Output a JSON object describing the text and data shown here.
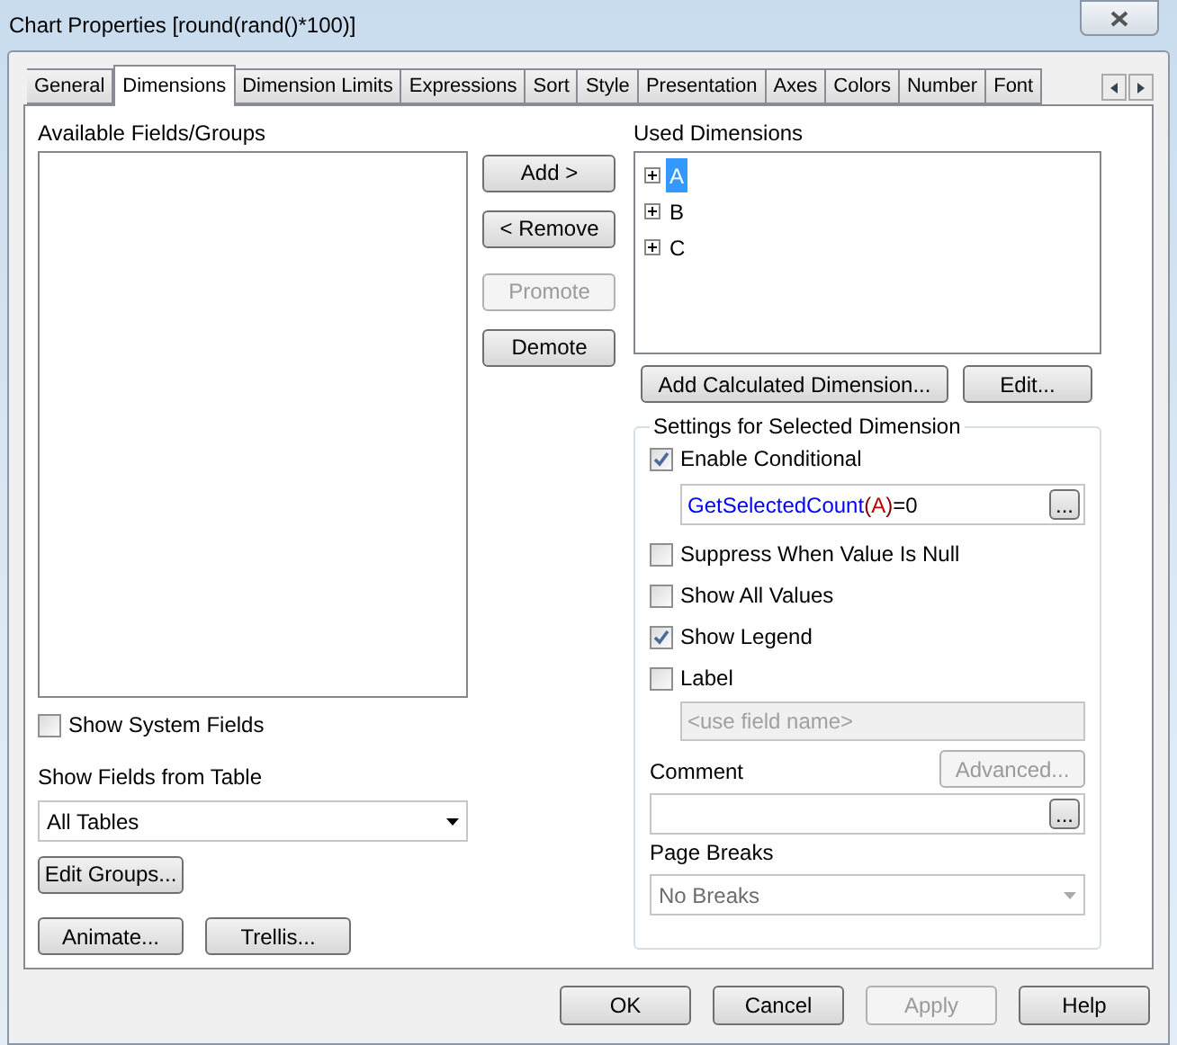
{
  "window": {
    "title": "Chart Properties [round(rand()*100)]"
  },
  "tabs": [
    {
      "label": "General",
      "selected": false
    },
    {
      "label": "Dimensions",
      "selected": true
    },
    {
      "label": "Dimension Limits",
      "selected": false
    },
    {
      "label": "Expressions",
      "selected": false
    },
    {
      "label": "Sort",
      "selected": false
    },
    {
      "label": "Style",
      "selected": false
    },
    {
      "label": "Presentation",
      "selected": false
    },
    {
      "label": "Axes",
      "selected": false
    },
    {
      "label": "Colors",
      "selected": false
    },
    {
      "label": "Number",
      "selected": false
    },
    {
      "label": "Font",
      "selected": false
    }
  ],
  "available": {
    "label": "Available Fields/Groups",
    "show_system_fields": {
      "label": "Show System Fields",
      "checked": false
    },
    "table_label": "Show Fields from Table",
    "table_value": "All Tables",
    "edit_groups": "Edit Groups...",
    "animate": "Animate...",
    "trellis": "Trellis..."
  },
  "move_buttons": [
    {
      "label": "Add >",
      "disabled": false
    },
    {
      "label": "< Remove",
      "disabled": false
    },
    {
      "label": "Promote",
      "disabled": true
    },
    {
      "label": "Demote",
      "disabled": false
    }
  ],
  "used": {
    "label": "Used Dimensions",
    "items": [
      {
        "label": "A",
        "selected": true
      },
      {
        "label": "B",
        "selected": false
      },
      {
        "label": "C",
        "selected": false
      }
    ],
    "add_calculated": "Add Calculated Dimension...",
    "edit": "Edit..."
  },
  "settings": {
    "title": "Settings for Selected Dimension",
    "enable_conditional": {
      "label": "Enable Conditional",
      "checked": true
    },
    "expression_tokens": [
      {
        "kind": "function",
        "text": "GetSelectedCount"
      },
      {
        "kind": "paren",
        "text": "("
      },
      {
        "kind": "field",
        "text": "A"
      },
      {
        "kind": "paren",
        "text": ")"
      },
      {
        "kind": "operator",
        "text": "=0"
      }
    ],
    "options": [
      {
        "label": "Suppress When Value Is Null",
        "checked": false
      },
      {
        "label": "Show All Values",
        "checked": false
      },
      {
        "label": "Show Legend",
        "checked": true
      },
      {
        "label": "Label",
        "checked": false
      }
    ],
    "expression_browse": "...",
    "comment_browse": "...",
    "label_placeholder": "<use field name>",
    "advanced": "Advanced...",
    "comment_label": "Comment",
    "page_breaks_label": "Page Breaks",
    "page_breaks_value": "No Breaks"
  },
  "buttons": [
    {
      "label": "OK",
      "disabled": false
    },
    {
      "label": "Cancel",
      "disabled": false
    },
    {
      "label": "Apply",
      "disabled": true
    },
    {
      "label": "Help",
      "disabled": false
    }
  ]
}
